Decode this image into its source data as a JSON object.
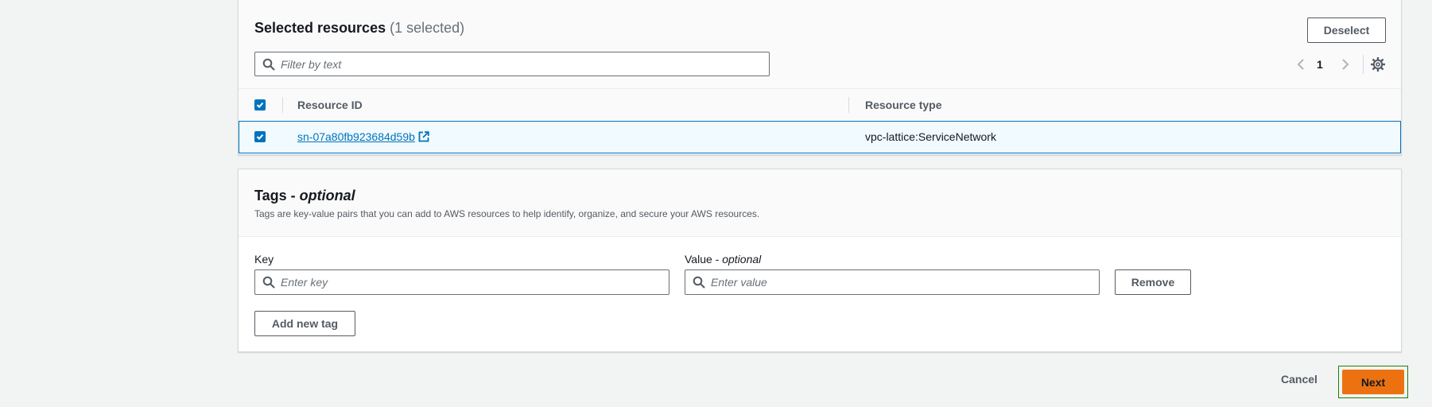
{
  "resources": {
    "title": "Selected resources",
    "count": "(1 selected)",
    "deselect_label": "Deselect",
    "filter_placeholder": "Filter by text",
    "page_number": "1",
    "columns": [
      "Resource ID",
      "Resource type"
    ],
    "rows": [
      {
        "resource_id": "sn-07a80fb923684d59b",
        "resource_type": "vpc-lattice:ServiceNetwork",
        "selected": true
      }
    ]
  },
  "tags": {
    "title": "Tags - ",
    "title_optional": "optional",
    "description": "Tags are key-value pairs that you can add to AWS resources to help identify, organize, and secure your AWS resources.",
    "key_label": "Key",
    "value_label": "Value - ",
    "value_optional": "optional",
    "key_placeholder": "Enter key",
    "value_placeholder": "Enter value",
    "remove_label": "Remove",
    "add_label": "Add new tag"
  },
  "footer": {
    "cancel_label": "Cancel",
    "next_label": "Next"
  },
  "colors": {
    "accent": "#0073bb",
    "primary_button": "#ec7211",
    "focus_ring": "#1d8102"
  },
  "icons": [
    "search-icon",
    "chevron-left-icon",
    "chevron-right-icon",
    "gear-icon",
    "external-link-icon",
    "checkmark-icon"
  ]
}
